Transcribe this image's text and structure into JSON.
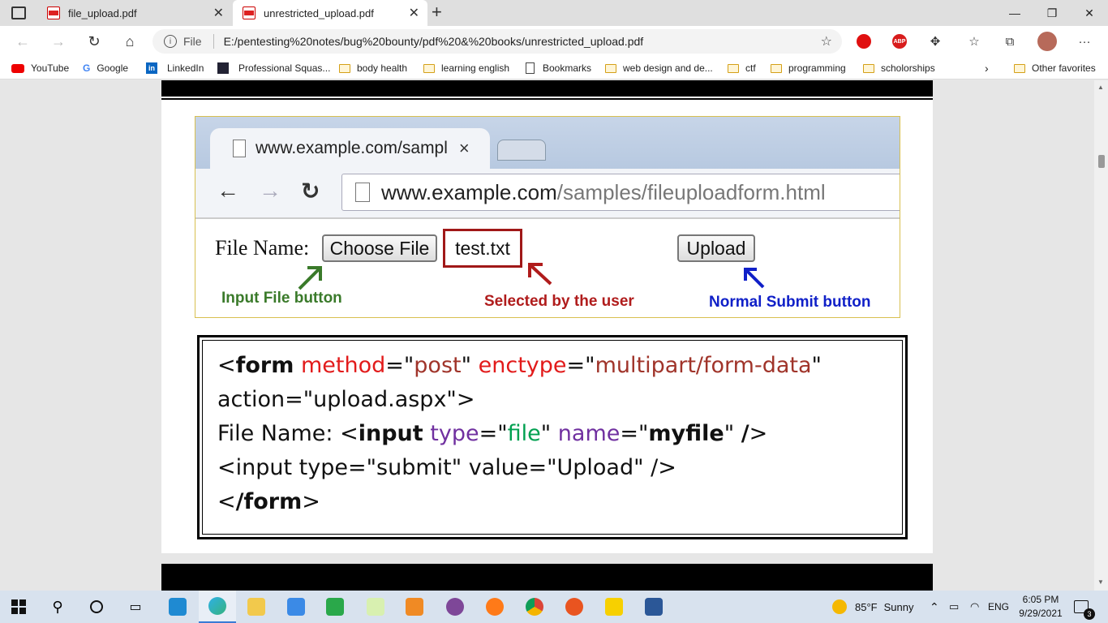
{
  "browser": {
    "tabs": [
      {
        "title": "file_upload.pdf",
        "active": false
      },
      {
        "title": "unrestricted_upload.pdf",
        "active": true
      }
    ],
    "new_tab": "+",
    "url_label": "File",
    "url": "E:/pentesting%20notes/bug%20bounty/pdf%20&%20books/unrestricted_upload.pdf",
    "extensions": [
      "abp-icon",
      "puzzle-icon",
      "favorites-icon",
      "collections-icon",
      "avatar",
      "more-icon"
    ],
    "abp_text": "ABP",
    "more": "···",
    "bookmarks": [
      {
        "label": "YouTube",
        "icon": "youtube-icon"
      },
      {
        "label": "Google",
        "icon": "google-icon"
      },
      {
        "label": "LinkedIn",
        "icon": "linkedin-icon"
      },
      {
        "label": "Professional Squas...",
        "icon": "site-icon"
      },
      {
        "label": "body health",
        "icon": "folder-icon"
      },
      {
        "label": "learning english",
        "icon": "folder-icon"
      },
      {
        "label": "Bookmarks",
        "icon": "page-icon"
      },
      {
        "label": "web design and de...",
        "icon": "folder-icon"
      },
      {
        "label": "ctf",
        "icon": "folder-icon"
      },
      {
        "label": "programming",
        "icon": "folder-icon"
      },
      {
        "label": "scholorships",
        "icon": "folder-icon"
      }
    ],
    "other_favorites": "Other favorites"
  },
  "figure": {
    "tab_title": "www.example.com/sampl",
    "tab_close": "×",
    "url_host": "www.example.com",
    "url_path": "/samples/fileuploadform.html",
    "file_name_label": "File Name:",
    "choose_file_button": "Choose File",
    "selected_file": "test.txt",
    "upload_button": "Upload",
    "annotations": {
      "input_file": "Input File button",
      "selected": "Selected by the user",
      "submit": "Normal Submit button"
    },
    "colors": {
      "green": "#3a7a2a",
      "red": "#b01c1c",
      "blue": "#1020c8"
    }
  },
  "code": {
    "l1_lt": "<",
    "l1_form": "form",
    "l1_method": "method",
    "l1_eq1": "=\"",
    "l1_post": "post",
    "l1_q1": "\" ",
    "l1_enctype": "enctype",
    "l1_eq2": "=\"",
    "l1_enc_val": "multipart/form-data",
    "l1_q2": "\"",
    "l2": "action=\"upload.aspx\">",
    "l3_pre": "File Name: <",
    "l3_input": "input",
    "l3_type": "type",
    "l3_eq1": "=\"",
    "l3_file": "file",
    "l3_q1": "\" ",
    "l3_name": "name",
    "l3_eq2": "=\"",
    "l3_myfile": "myfile",
    "l3_q2": "\" ",
    "l3_slash": "/",
    "l3_gt": ">",
    "l4": "<input type=\"submit\" value=\"Upload\" />",
    "l5_lt": "<",
    "l5_form": "/form",
    "l5_gt": ">"
  },
  "taskbar": {
    "weather_temp": "85°F",
    "weather_text": "Sunny",
    "lang": "ENG",
    "time": "6:05 PM",
    "date": "9/29/2021",
    "notifications": "3"
  }
}
